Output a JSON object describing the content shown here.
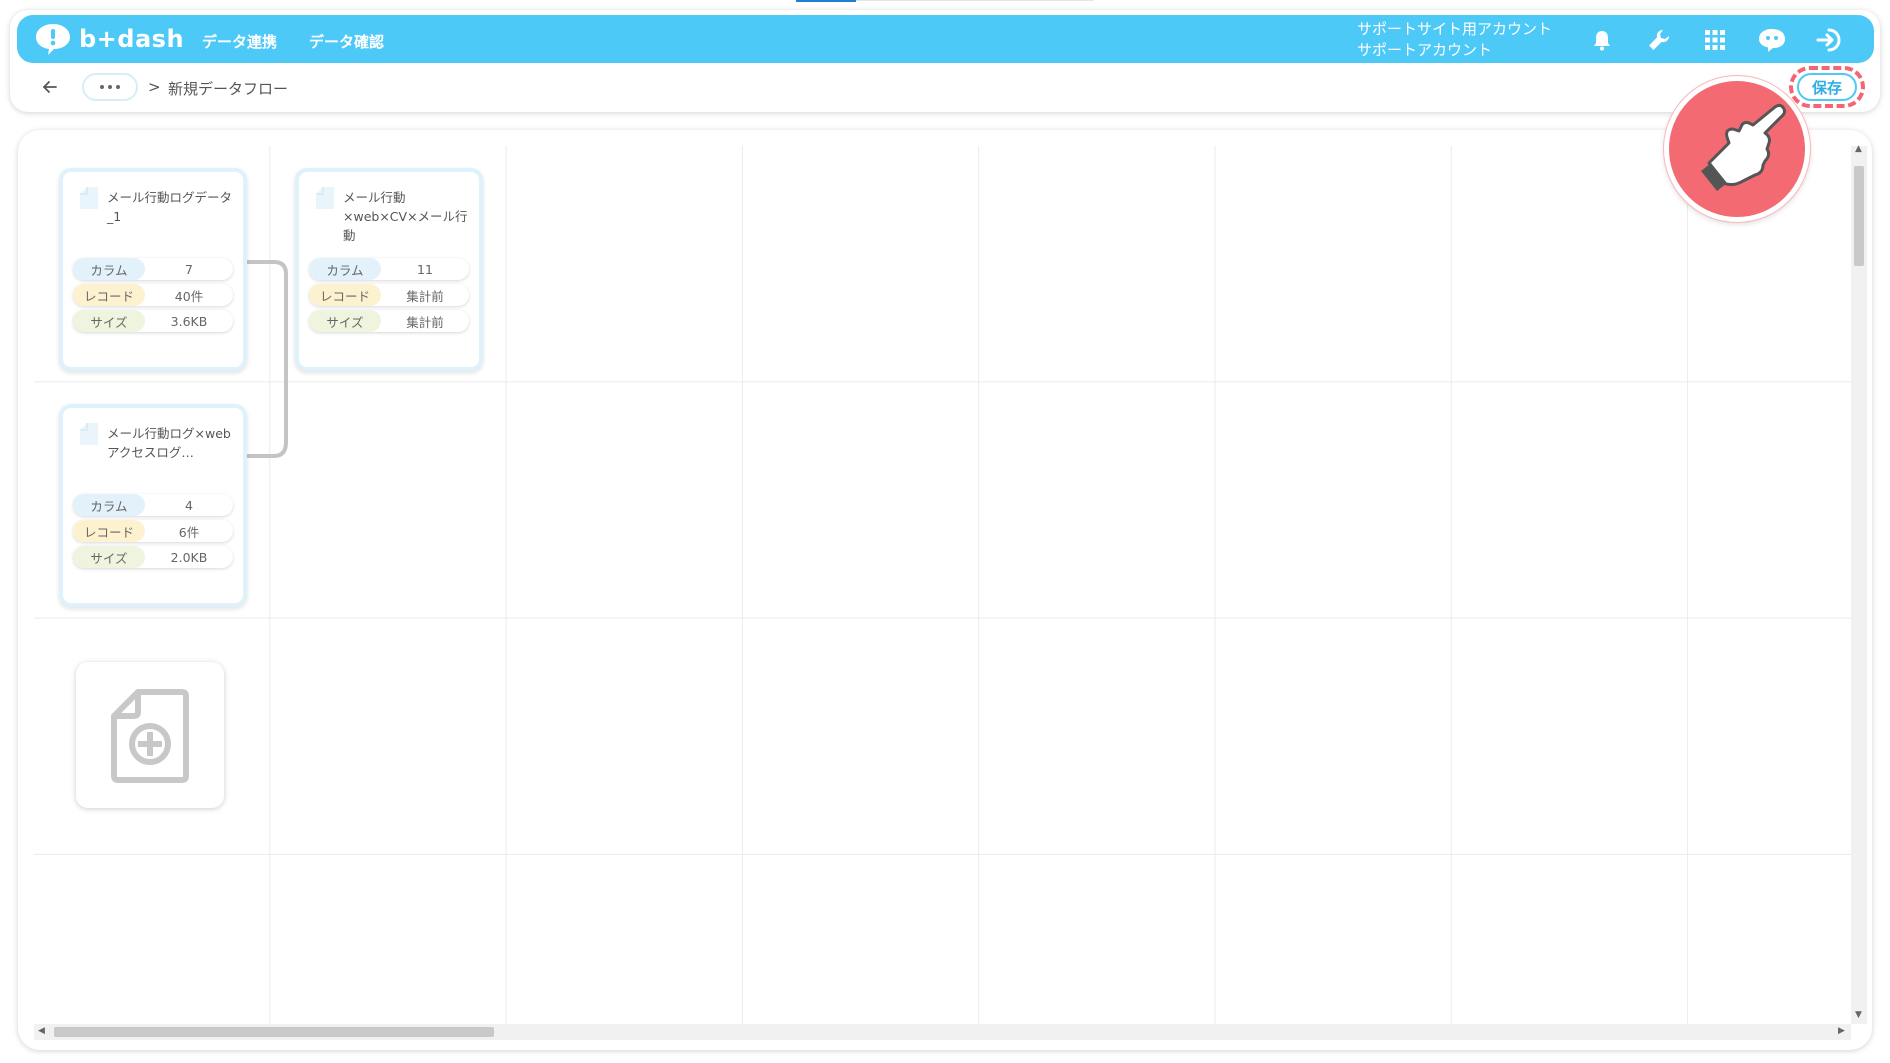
{
  "header": {
    "logo_text": "b+dash",
    "nav": [
      {
        "label": "データ連携"
      },
      {
        "label": "データ確認"
      }
    ],
    "account_line1": "サポートサイト用アカウント",
    "account_line2": "サポートアカウント",
    "icons": [
      "bell-icon",
      "wrench-icon",
      "grid-icon",
      "chat-bot-icon",
      "logout-icon"
    ]
  },
  "breadcrumb": {
    "separator": ">",
    "title": "新規データフロー"
  },
  "toolbar": {
    "save_label": "保存"
  },
  "cards": [
    {
      "title": "メール行動ログデータ_1",
      "rows": [
        {
          "label": "カラム",
          "value": "7"
        },
        {
          "label": "レコード",
          "value": "40件"
        },
        {
          "label": "サイズ",
          "value": "3.6KB"
        }
      ]
    },
    {
      "title": "メール行動×web×CV×メール行動",
      "rows": [
        {
          "label": "カラム",
          "value": "11"
        },
        {
          "label": "レコード",
          "value": "集計前"
        },
        {
          "label": "サイズ",
          "value": "集計前"
        }
      ]
    },
    {
      "title": "メール行動ログ×webアクセスログ…",
      "rows": [
        {
          "label": "カラム",
          "value": "4"
        },
        {
          "label": "レコード",
          "value": "6件"
        },
        {
          "label": "サイズ",
          "value": "2.0KB"
        }
      ]
    }
  ],
  "colors": {
    "brand": "#4dc9f8",
    "column_badge": "#e3f1fb",
    "record_badge": "#fdf2cf",
    "size_badge": "#eef4dd",
    "highlight": "#f36a72"
  }
}
